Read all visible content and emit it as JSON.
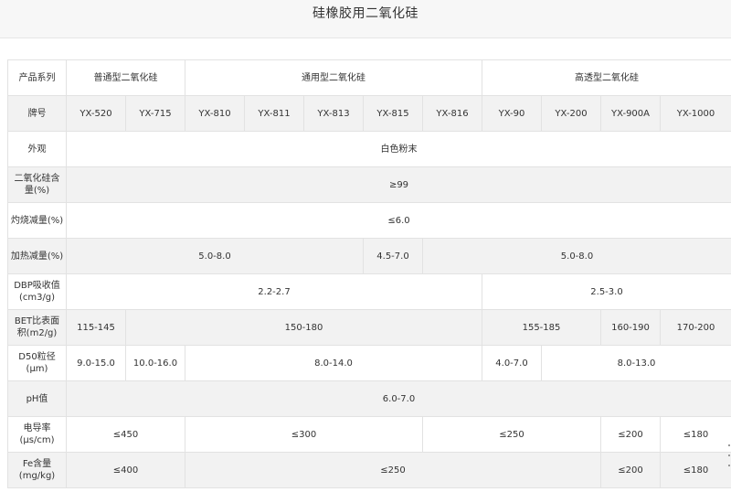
{
  "title": "硅橡胶用二氧化硅",
  "rows": {
    "series": {
      "label": "产品系列",
      "cells": [
        "普通型二氧化硅",
        "通用型二氧化硅",
        "高透型二氧化硅"
      ]
    },
    "grade": {
      "label": "牌号",
      "cells": [
        "YX-520",
        "YX-715",
        "YX-810",
        "YX-811",
        "YX-813",
        "YX-815",
        "YX-816",
        "YX-90",
        "YX-200",
        "YX-900A",
        "YX-1000"
      ]
    },
    "appearance": {
      "label": "外观",
      "cells": [
        "白色粉末"
      ]
    },
    "sio2_content": {
      "label": "二氧化硅含量(%)",
      "cells": [
        "≥99"
      ]
    },
    "ignition_loss": {
      "label": "灼烧减量(%)",
      "cells": [
        "≤6.0"
      ]
    },
    "heating_loss": {
      "label": "加热减量(%)",
      "cells": [
        "5.0-8.0",
        "4.5-7.0",
        "5.0-8.0"
      ]
    },
    "dbp": {
      "label": "DBP吸收值(cm3/g)",
      "cells": [
        "2.2-2.7",
        "2.5-3.0"
      ]
    },
    "bet": {
      "label": "BET比表面积(m2/g)",
      "cells": [
        "115-145",
        "150-180",
        "155-185",
        "160-190",
        "170-200"
      ]
    },
    "d50": {
      "label": "D50粒径(μm)",
      "cells": [
        "9.0-15.0",
        "10.0-16.0",
        "8.0-14.0",
        "4.0-7.0",
        "8.0-13.0"
      ]
    },
    "ph": {
      "label": "pH值",
      "cells": [
        "6.0-7.0"
      ]
    },
    "conductivity": {
      "label": "电导率(μs/cm)",
      "cells": [
        "≤450",
        "≤300",
        "≤250",
        "≤200",
        "≤180"
      ]
    },
    "fe": {
      "label": "Fe含量(mg/kg)",
      "cells": [
        "≤400",
        "≤250",
        "≤200",
        "≤180"
      ]
    }
  }
}
